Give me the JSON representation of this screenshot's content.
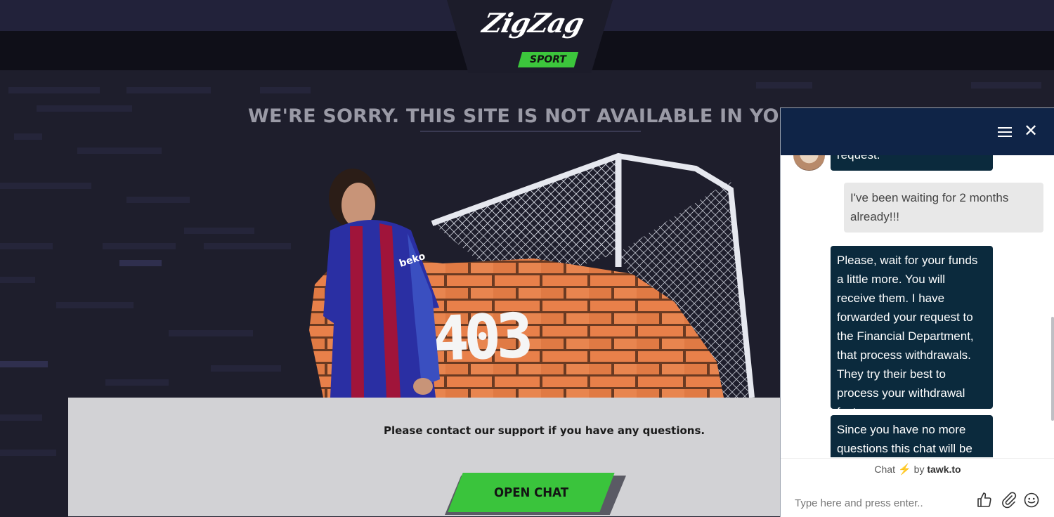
{
  "logo": {
    "brand": "ZigZag",
    "tag": "SPORT"
  },
  "notice": {
    "sorry": "WE'RE SORRY. THIS SITE IS NOT AVAILABLE IN YOUR REGI",
    "error_code": "403",
    "contact": "Please contact our support if you have any questions.",
    "open_chat": "OPEN CHAT"
  },
  "chat": {
    "messages": [
      {
        "from": "agent",
        "text": "request."
      },
      {
        "from": "visitor",
        "text": "I've been waiting for 2 months already!!!"
      },
      {
        "from": "agent",
        "text": "Please, wait for your funds a little more. You will receive them. I have forwarded your request to the Financial Department, that process withdrawals. They try their best to process your withdrawal faster."
      },
      {
        "from": "agent",
        "text": "Since you have no more questions this chat will be"
      }
    ],
    "powered_prefix": "Chat",
    "powered_by": "by",
    "powered_brand": "tawk.to",
    "input_placeholder": "Type here and press enter.."
  },
  "colors": {
    "accent_green": "#3ac43c",
    "chat_header": "#0f2447",
    "agent_bubble": "#0b2a3d"
  }
}
